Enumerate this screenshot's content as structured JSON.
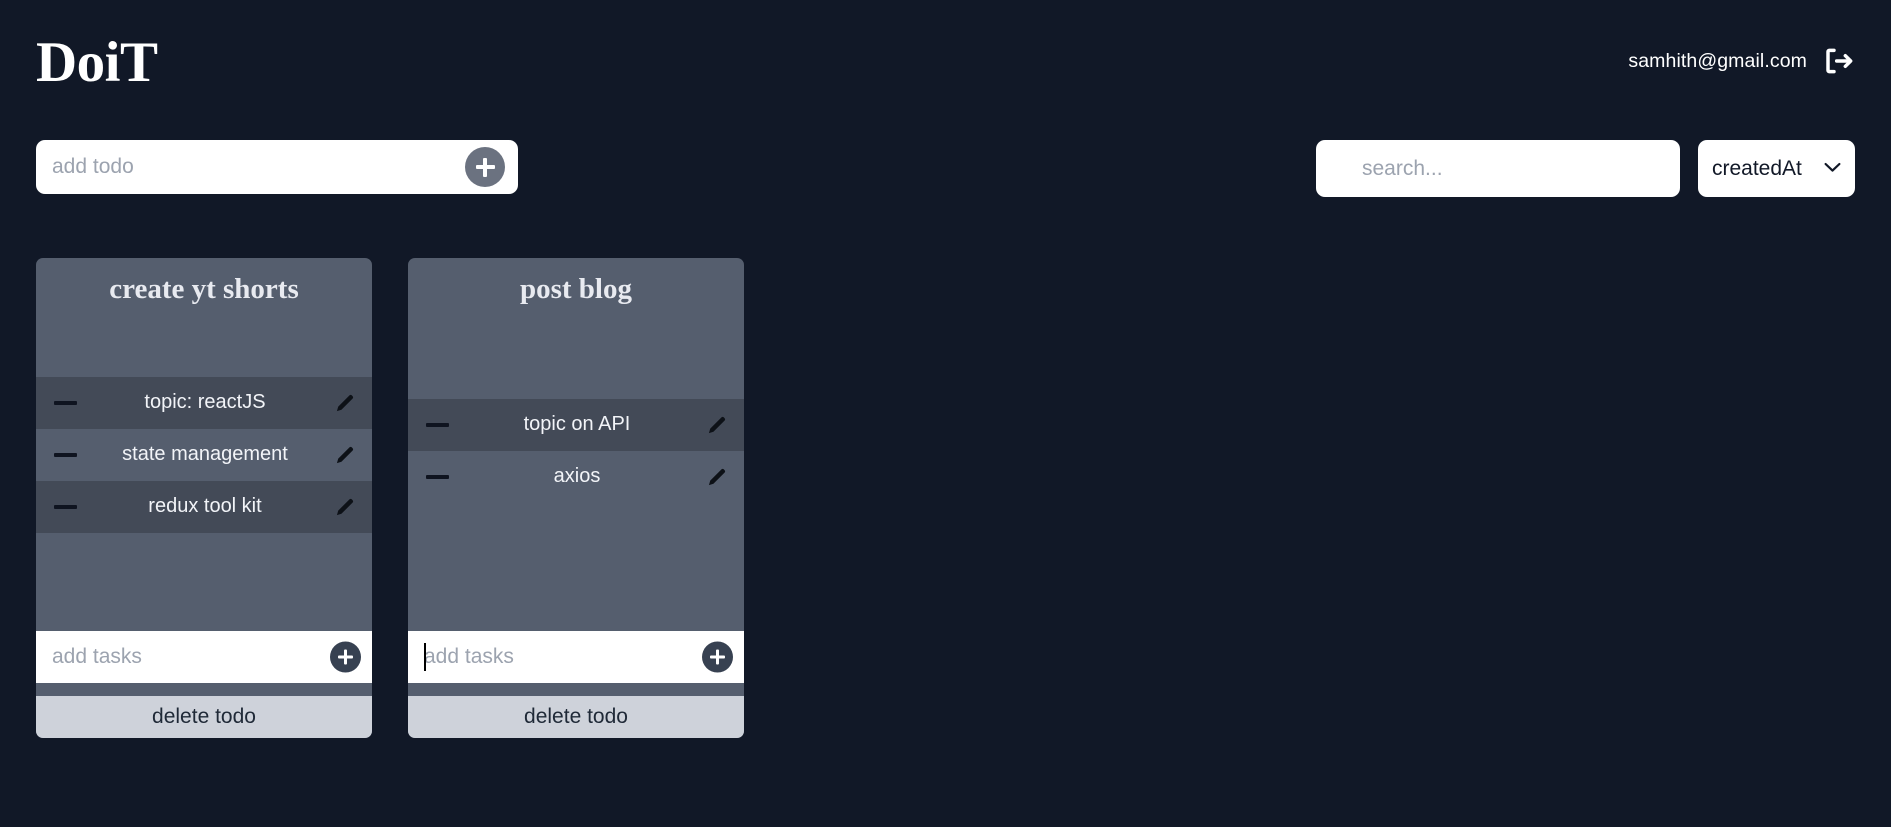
{
  "colors": {
    "page_background": "#111827",
    "card_background": "#555e6e",
    "card_row_alt": "#434a57",
    "accent_button": "#6b7280",
    "delete_button": "#ced2da"
  },
  "header": {
    "brand": "DoiT",
    "user_email": "samhith@gmail.com",
    "logout_icon": "logout-icon"
  },
  "toolbar": {
    "add_todo_placeholder": "add todo",
    "add_todo_value": "",
    "add_todo_button_icon": "plus-icon",
    "search_placeholder": "search...",
    "search_value": "",
    "search_icon": "search-icon",
    "sort_selected": "createdAt",
    "sort_options": [
      "createdAt"
    ],
    "sort_chevron_icon": "chevron-down-icon"
  },
  "board": {
    "todos": [
      {
        "title": "create yt shorts",
        "tasks": [
          {
            "text": "topic: reactJS",
            "remove_icon": "minus-icon",
            "edit_icon": "pencil-icon"
          },
          {
            "text": "state management",
            "remove_icon": "minus-icon",
            "edit_icon": "pencil-icon"
          },
          {
            "text": "redux tool kit",
            "remove_icon": "minus-icon",
            "edit_icon": "pencil-icon"
          }
        ],
        "add_task_placeholder": "add tasks",
        "add_task_value": "",
        "add_task_focused": false,
        "add_task_button_icon": "plus-icon",
        "delete_label": "delete todo"
      },
      {
        "title": "post blog",
        "tasks": [
          {
            "text": "topic on API",
            "remove_icon": "minus-icon",
            "edit_icon": "pencil-icon"
          },
          {
            "text": "axios",
            "remove_icon": "minus-icon",
            "edit_icon": "pencil-icon"
          }
        ],
        "add_task_placeholder": "add tasks",
        "add_task_value": "",
        "add_task_focused": true,
        "add_task_button_icon": "plus-icon",
        "delete_label": "delete todo"
      }
    ]
  }
}
